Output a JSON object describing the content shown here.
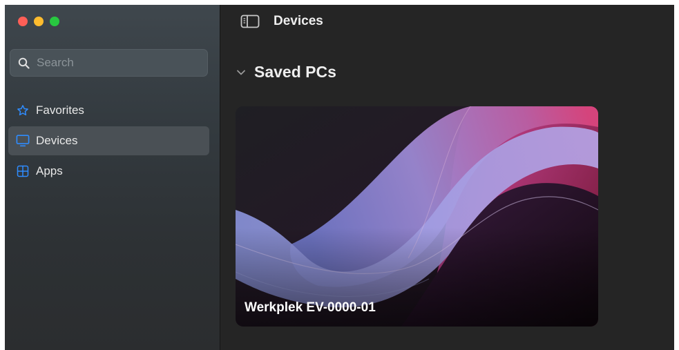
{
  "window_controls": [
    "close",
    "minimize",
    "zoom"
  ],
  "sidebar": {
    "search": {
      "placeholder": "Search",
      "value": ""
    },
    "items": [
      {
        "label": "Favorites",
        "icon": "star-icon",
        "active": false
      },
      {
        "label": "Devices",
        "icon": "monitor-icon",
        "active": true
      },
      {
        "label": "Apps",
        "icon": "apps-grid-icon",
        "active": false
      }
    ]
  },
  "header": {
    "title": "Devices",
    "toggle_icon": "sidebar-toggle-icon"
  },
  "main": {
    "section": {
      "title": "Saved PCs",
      "expanded": true,
      "chevron_icon": "chevron-down-icon"
    },
    "pcs": [
      {
        "name": "Werkplek EV-0000-01"
      }
    ]
  },
  "colors": {
    "accent": "#2f8cff"
  }
}
